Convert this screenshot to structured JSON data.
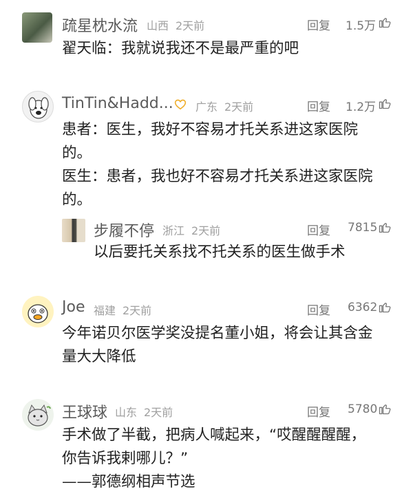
{
  "ui": {
    "reply_label": "回复"
  },
  "comments": [
    {
      "username": "疏星枕水流",
      "location": "山西",
      "time": "2天前",
      "likes": "1.5万",
      "lines": [
        "翟天临：我就说我还不是最严重的吧"
      ]
    },
    {
      "username": "TinTin&Hadd...",
      "location": "广东",
      "time": "2天前",
      "likes": "1.2万",
      "lines": [
        "患者：医生，我好不容易才托关系进这家医院",
        "的。",
        "医生：患者，我也好不容易才托关系进这家医院",
        "的。"
      ]
    },
    {
      "username": "步履不停",
      "location": "浙江",
      "time": "2天前",
      "likes": "7815",
      "lines": [
        "以后要托关系找不托关系的医生做手术"
      ]
    },
    {
      "username": "Joe",
      "location": "福建",
      "time": "2天前",
      "likes": "6362",
      "lines": [
        "今年诺贝尔医学奖没提名董小姐，将会让其含金",
        "量大大降低"
      ]
    },
    {
      "username": "王球球",
      "location": "山东",
      "time": "2天前",
      "likes": "5780",
      "lines": [
        "手术做了半截，把病人喊起来，“哎醒醒醒醒，",
        "你告诉我剌哪儿？”",
        "——郭德纲相声节选"
      ]
    }
  ],
  "icons": {
    "thumb": "thumbs-up-icon",
    "badge": "heart-badge-icon"
  },
  "colors": {
    "name": "#5a5a5a",
    "meta": "#a0a0a0",
    "text": "#222222",
    "badge": "#f0b030"
  }
}
